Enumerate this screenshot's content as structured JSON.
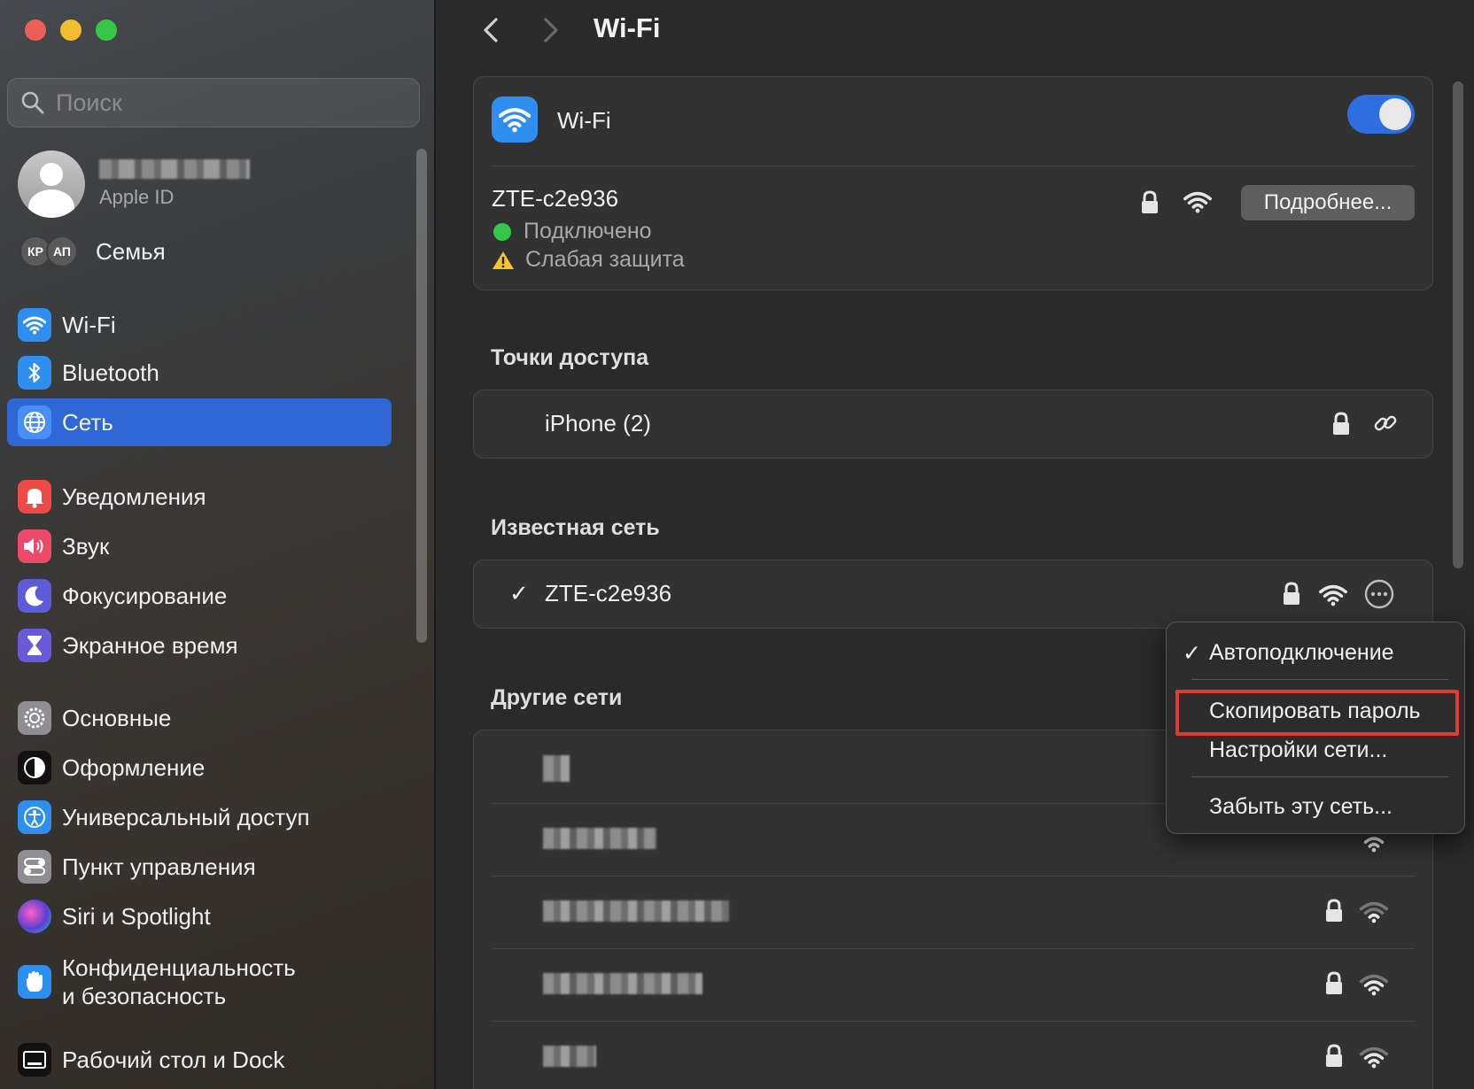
{
  "window": {
    "title": "Wi-Fi"
  },
  "search": {
    "placeholder": "Поиск"
  },
  "account": {
    "subtitle": "Apple ID"
  },
  "family": {
    "members": [
      "КР",
      "АП"
    ],
    "label": "Семья"
  },
  "sidebar": {
    "items": [
      {
        "label": "Wi-Fi",
        "icon": "wifi-icon",
        "color": "#2f8ff0"
      },
      {
        "label": "Bluetooth",
        "icon": "bluetooth-icon",
        "color": "#2f8ff0"
      },
      {
        "label": "Сеть",
        "icon": "globe-icon",
        "color": "#2f8ff0",
        "active": true
      },
      {
        "label": "Уведомления",
        "icon": "bell-icon",
        "color": "#ef4b46"
      },
      {
        "label": "Звук",
        "icon": "speaker-icon",
        "color": "#ed4a6a"
      },
      {
        "label": "Фокусирование",
        "icon": "moon-icon",
        "color": "#5f5bd6"
      },
      {
        "label": "Экранное время",
        "icon": "hourglass-icon",
        "color": "#6a5ad8"
      },
      {
        "label": "Основные",
        "icon": "gear-icon",
        "color": "#8e8e93"
      },
      {
        "label": "Оформление",
        "icon": "appearance-icon",
        "color": "#111111"
      },
      {
        "label": "Универсальный доступ",
        "icon": "accessibility-icon",
        "color": "#2f8ff0"
      },
      {
        "label": "Пункт управления",
        "icon": "control-center-icon",
        "color": "#8e8e93"
      },
      {
        "label": "Siri и Spotlight",
        "icon": "siri-icon",
        "color": "#5b3fd1"
      },
      {
        "label": "Конфиденциальность",
        "label2": "и безопасность",
        "icon": "hand-icon",
        "color": "#2f8ff0"
      },
      {
        "label": "Рабочий стол и Dock",
        "icon": "dock-icon",
        "color": "#111111"
      }
    ]
  },
  "wifi": {
    "label": "Wi-Fi",
    "enabled": true,
    "current_network": "ZTE-c2e936",
    "status_connected": "Подключено",
    "status_security": "Слабая защита",
    "details_button": "Подробнее..."
  },
  "hotspots": {
    "title": "Точки доступа",
    "items": [
      {
        "name": "iPhone (2)"
      }
    ]
  },
  "known": {
    "title": "Известная сеть",
    "items": [
      {
        "name": "ZTE-c2e936",
        "checked": true
      }
    ]
  },
  "other": {
    "title": "Другие сети"
  },
  "menu": {
    "auto_connect": "Автоподключение",
    "copy_password": "Скопировать пароль",
    "network_settings": "Настройки сети...",
    "forget": "Забыть эту сеть..."
  },
  "colors": {
    "accent": "#2f67d6",
    "toggle_on": "#2f6ee0",
    "connected": "#34c748",
    "warning": "#f4c430",
    "highlight": "#e23b2e"
  }
}
